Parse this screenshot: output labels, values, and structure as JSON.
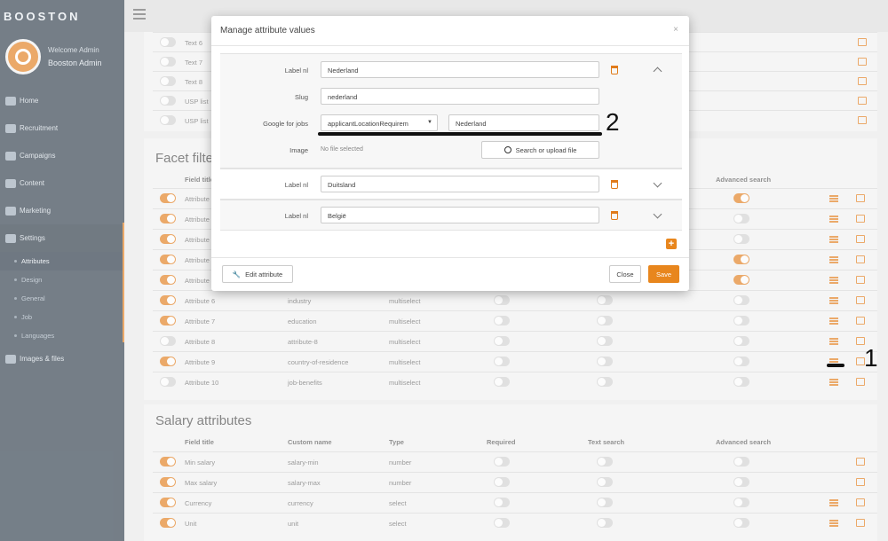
{
  "app": {
    "logo": "BOOSTON"
  },
  "user": {
    "welcome": "Welcome Admin",
    "name": "Booston Admin"
  },
  "nav": {
    "items": [
      {
        "label": "Home",
        "icon": "home-icon"
      },
      {
        "label": "Recruitment",
        "icon": "users-icon"
      },
      {
        "label": "Campaigns",
        "icon": "chart-icon"
      },
      {
        "label": "Content",
        "icon": "document-icon"
      },
      {
        "label": "Marketing",
        "icon": "line-chart-icon"
      },
      {
        "label": "Settings",
        "icon": "gear-icon"
      }
    ],
    "sub_items": [
      {
        "label": "Attributes"
      },
      {
        "label": "Design"
      },
      {
        "label": "General"
      },
      {
        "label": "Job"
      },
      {
        "label": "Languages"
      }
    ],
    "last": {
      "label": "Images & files",
      "icon": "image-icon"
    }
  },
  "background": {
    "top_rows": [
      {
        "title": "Text 6"
      },
      {
        "title": "Text 7"
      },
      {
        "title": "Text 8"
      },
      {
        "title": "USP list"
      },
      {
        "title": "USP list"
      }
    ],
    "facet_title": "Facet filte",
    "facet_header": {
      "field": "Field title",
      "advanced": "Advanced search"
    },
    "facet_rows": [
      {
        "title": "Attribute",
        "name": "",
        "type": "",
        "main_toggle": true,
        "adv": true
      },
      {
        "title": "Attribute",
        "name": "",
        "type": "",
        "main_toggle": true,
        "adv": false
      },
      {
        "title": "Attribute",
        "name": "",
        "type": "",
        "main_toggle": true,
        "adv": false
      },
      {
        "title": "Attribute",
        "name": "",
        "type": "",
        "main_toggle": true,
        "adv": true
      },
      {
        "title": "Attribute",
        "name": "",
        "type": "",
        "main_toggle": true,
        "adv": true
      },
      {
        "title": "Attribute 6",
        "name": "industry",
        "type": "multiselect",
        "main_toggle": true,
        "adv": false
      },
      {
        "title": "Attribute 7",
        "name": "education",
        "type": "multiselect",
        "main_toggle": true,
        "adv": false
      },
      {
        "title": "Attribute 8",
        "name": "attribute-8",
        "type": "multiselect",
        "main_toggle": false,
        "adv": false
      },
      {
        "title": "Attribute 9",
        "name": "country-of-residence",
        "type": "multiselect",
        "main_toggle": true,
        "adv": false
      },
      {
        "title": "Attribute 10",
        "name": "job-benefits",
        "type": "multiselect",
        "main_toggle": false,
        "adv": false
      }
    ],
    "salary_title": "Salary attributes",
    "salary_header": {
      "field": "Field title",
      "custom": "Custom name",
      "type": "Type",
      "required": "Required",
      "text": "Text search",
      "advanced": "Advanced search"
    },
    "salary_rows": [
      {
        "title": "Min salary",
        "name": "salary-min",
        "type": "number"
      },
      {
        "title": "Max salary",
        "name": "salary-max",
        "type": "number"
      },
      {
        "title": "Currency",
        "name": "currency",
        "type": "select"
      },
      {
        "title": "Unit",
        "name": "unit",
        "type": "select"
      }
    ]
  },
  "modal": {
    "title": "Manage attribute values",
    "close_glyph": "×",
    "first": {
      "label_nl": "Label nl",
      "label_value": "Nederland",
      "slug_label": "Slug",
      "slug_value": "nederland",
      "google_label": "Google for jobs",
      "google_select": "applicantLocationRequirem",
      "google_value": "Nederland",
      "image_label": "Image",
      "no_file": "No file selected",
      "upload_btn": "Search or upload file"
    },
    "second": {
      "label_nl": "Label nl",
      "value": "Duitsland"
    },
    "third": {
      "label_nl": "Label nl",
      "value": "België"
    },
    "edit_btn": "Edit attribute",
    "close_btn": "Close",
    "save_btn": "Save"
  },
  "annotations": {
    "one": "1",
    "two": "2"
  }
}
